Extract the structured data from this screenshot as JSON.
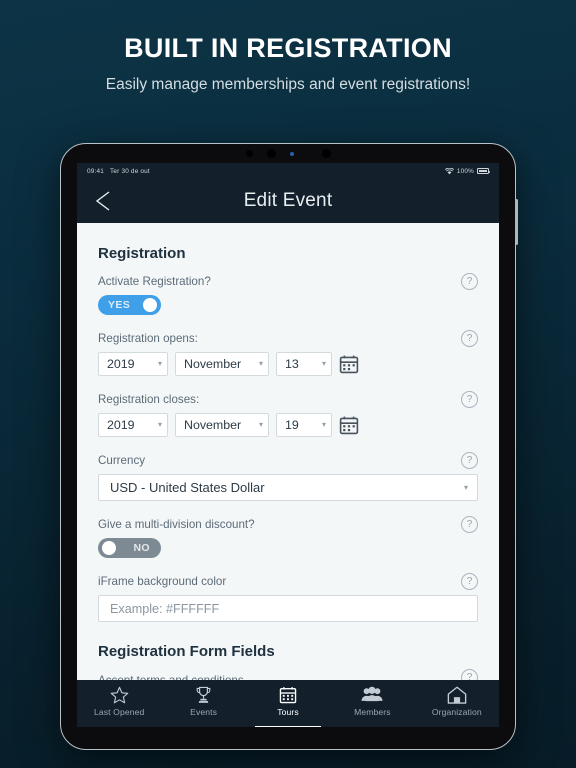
{
  "promo": {
    "title": "BUILT IN REGISTRATION",
    "subtitle": "Easily manage memberships and event registrations!"
  },
  "device": {
    "statusbar": {
      "time": "09:41",
      "date": "Ter 30 de out",
      "battery_percent": "100%",
      "wifi_icon": "wifi-icon",
      "battery_icon": "battery-icon"
    },
    "navbar": {
      "back_icon": "back-chevron-icon",
      "title": "Edit Event"
    },
    "form": {
      "section_title": "Registration",
      "activate": {
        "label": "Activate Registration?",
        "toggle_value": "YES",
        "toggle_state": "on",
        "help_icon": "?"
      },
      "opens": {
        "label": "Registration opens:",
        "year": "2019",
        "month": "November",
        "day": "13",
        "calendar_icon": "calendar-icon",
        "help_icon": "?"
      },
      "closes": {
        "label": "Registration closes:",
        "year": "2019",
        "month": "November",
        "day": "19",
        "calendar_icon": "calendar-icon",
        "help_icon": "?"
      },
      "currency": {
        "label": "Currency",
        "value": "USD - United States Dollar",
        "help_icon": "?"
      },
      "discount": {
        "label": "Give a multi-division discount?",
        "toggle_value": "NO",
        "toggle_state": "off",
        "help_icon": "?"
      },
      "iframe_color": {
        "label": "iFrame background color",
        "placeholder": "Example: #FFFFFF",
        "value": "",
        "help_icon": "?"
      },
      "form_fields_section": {
        "title": "Registration Form Fields",
        "first_item": "Accept terms and conditions",
        "help_icon": "?"
      }
    },
    "tabbar": {
      "tabs": [
        {
          "label": "Last Opened",
          "icon": "star-icon",
          "active": false
        },
        {
          "label": "Events",
          "icon": "trophy-icon",
          "active": false
        },
        {
          "label": "Tours",
          "icon": "calendar-icon",
          "active": true
        },
        {
          "label": "Members",
          "icon": "people-icon",
          "active": false
        },
        {
          "label": "Organization",
          "icon": "home-icon",
          "active": false
        }
      ]
    }
  },
  "colors": {
    "background_top": "#0c3446",
    "background_bottom": "#071c27",
    "chrome_dark": "#13202b",
    "screen_bg": "#f4f7f8",
    "toggle_on": "#3f9fe8",
    "toggle_off": "#7d8a94",
    "label_text": "#5c6b78",
    "heading_text": "#20323f"
  }
}
